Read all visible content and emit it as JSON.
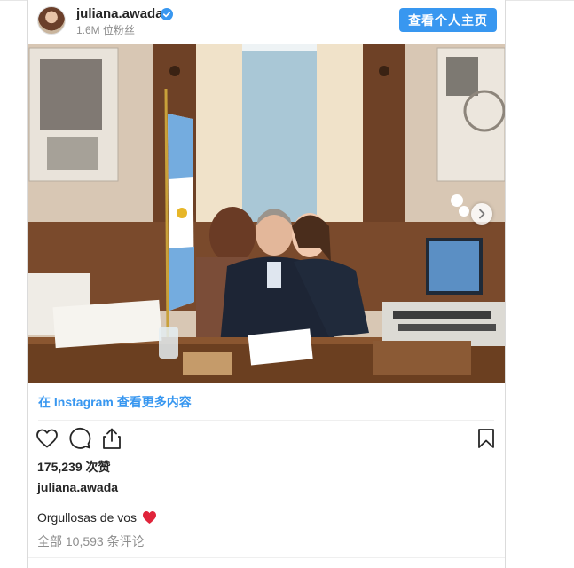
{
  "post": {
    "username": "juliana.awada",
    "followers": "1.6M 位粉丝",
    "profile_button": "查看个人主页",
    "more_link": "在 Instagram 查看更多内容",
    "likes": "175,239 次赞",
    "caption_user": "juliana.awada",
    "caption_text": "Orgullosas de vos",
    "comments": "全部 10,593 条评论"
  },
  "icons": [
    "heart-icon",
    "comment-icon",
    "share-icon",
    "bookmark-icon",
    "verified-badge-icon",
    "chevron-right-icon"
  ],
  "colors": {
    "accent": "#3897f0",
    "text": "#262626",
    "secondary": "#8e8e8e",
    "emoji_heart": "#e0243b"
  }
}
